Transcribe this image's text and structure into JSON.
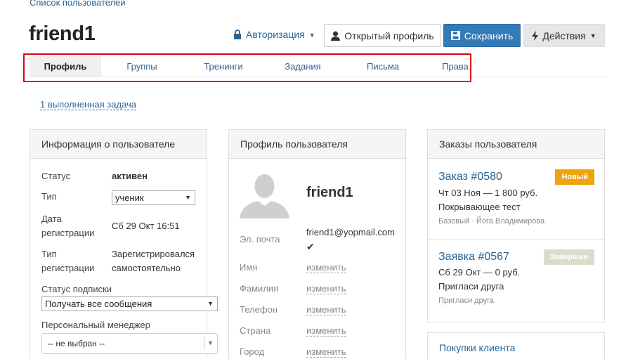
{
  "breadcrumb": "Список пользователей",
  "page_title": "friend1",
  "header": {
    "auth_label": "Авторизация",
    "open_profile_label": "Открытый профиль",
    "save_label": "Сохранить",
    "actions_label": "Действия"
  },
  "tabs": [
    {
      "label": "Профиль",
      "active": true
    },
    {
      "label": "Группы"
    },
    {
      "label": "Тренинги"
    },
    {
      "label": "Задания"
    },
    {
      "label": "Письма"
    },
    {
      "label": "Права"
    }
  ],
  "tasks_link": "1 выполненная задача",
  "user_info": {
    "title": "Информация о пользователе",
    "status_label": "Статус",
    "status_value": "активен",
    "type_label": "Тип",
    "type_value": "ученик",
    "reg_date_label_1": "Дата",
    "reg_date_label_2": "регистрации",
    "reg_date_value": "Сб 29 Окт 16:51",
    "reg_type_label_1": "Тип",
    "reg_type_label_2": "регистрации",
    "reg_type_value_1": "Зарегистрировался",
    "reg_type_value_2": "самостоятельно",
    "subscription_label": "Статус подписки",
    "subscription_value": "Получать все сообщения",
    "manager_label": "Персональный менеджер",
    "manager_value": "-- не выбран --"
  },
  "user_profile": {
    "title": "Профиль пользователя",
    "name": "friend1",
    "email_label": "Эл. почта",
    "email_value": "friend1@yopmail.com",
    "edit_label": "изменить",
    "fields": [
      "Имя",
      "Фамилия",
      "Телефон",
      "Страна",
      "Город"
    ]
  },
  "orders": {
    "title": "Заказы пользователя",
    "items": [
      {
        "title": "Заказ #0580",
        "badge": "Новый",
        "badge_color": "#f0a30a",
        "line1": "Чт 03 Ноя — 1 800 руб.",
        "line2": "Покрывающее тест",
        "meta": "Базовый · Йога Владимирова"
      },
      {
        "title": "Заявка #0567",
        "badge": "Завершен",
        "badge_color": "#dcdccc",
        "line1": "Сб 29 Окт — 0 руб.",
        "line2": "Пригласи друга",
        "meta": "Пригласи друга"
      }
    ]
  },
  "purchases": {
    "title": "Покупки клиента"
  },
  "colors": {
    "primary": "#337ab7",
    "link": "#2a6496",
    "highlight": "#e0000b"
  }
}
